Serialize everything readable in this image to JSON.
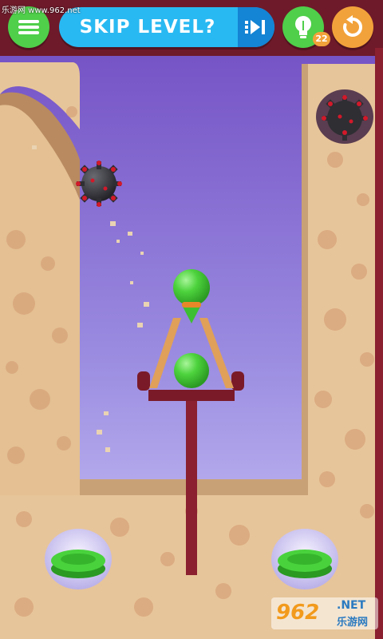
{
  "header": {
    "skip_label": "SKIP LEVEL?",
    "hint_count": "22"
  },
  "watermark": {
    "site": "乐游网 www.962.net",
    "logo_number": "962",
    "logo_tld": ".NET",
    "logo_cn": "乐游网"
  },
  "icons": {
    "menu": "menu-icon",
    "skip": "skip-forward-icon",
    "hint": "lightbulb-icon",
    "restart": "restart-icon"
  },
  "colors": {
    "sky_top": "#7a55c8",
    "sky_bottom": "#b3a8f0",
    "sand": "#e7c59a",
    "ball": "#49d23c",
    "bomb": "#2e2e33",
    "pole": "#8a2030"
  }
}
